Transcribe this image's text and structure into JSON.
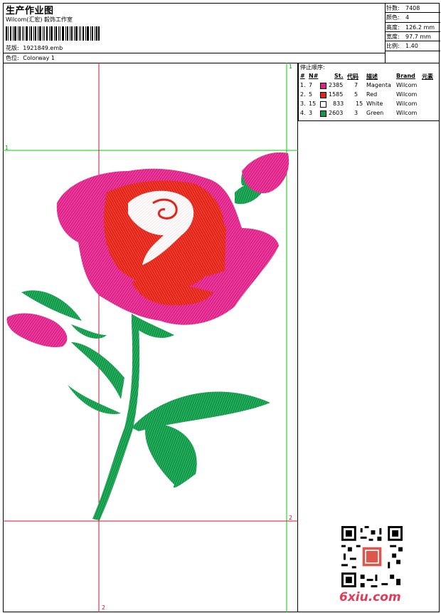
{
  "header": {
    "title": "生产作业图",
    "subtitle": "Wilcom(汇宏) 毅饰工作室",
    "design_file_label": "花版:",
    "design_file": "1921849.emb",
    "colorway_label": "色位:",
    "colorway": "Colorway 1"
  },
  "stats": [
    {
      "label": "针数:",
      "value": "7408"
    },
    {
      "label": "颜色:",
      "value": "4"
    },
    {
      "label": "高度:",
      "value": "126.2 mm"
    },
    {
      "label": "宽度:",
      "value": "97.7 mm"
    },
    {
      "label": "比例:",
      "value": "1.40"
    }
  ],
  "stop_sequence": {
    "title": "停止顺序:",
    "headers": {
      "num": "#",
      "n": "N#",
      "st": "St.",
      "code": "代码",
      "desc": "描述",
      "brand": "Brand",
      "elem": "元素"
    },
    "rows": [
      {
        "idx": "1.",
        "n": "7",
        "color": "#e0218a",
        "st": "2385",
        "code": "7",
        "desc": "Magenta",
        "brand": "Wilcom"
      },
      {
        "idx": "2.",
        "n": "5",
        "color": "#e3241b",
        "st": "1585",
        "code": "5",
        "desc": "Red",
        "brand": "Wilcom"
      },
      {
        "idx": "3.",
        "n": "15",
        "color": "#ffffff",
        "st": "833",
        "code": "15",
        "desc": "White",
        "brand": "Wilcom"
      },
      {
        "idx": "4.",
        "n": "3",
        "color": "#0f9a4a",
        "st": "2603",
        "code": "3",
        "desc": "Green",
        "brand": "Wilcom"
      }
    ]
  },
  "guides": {
    "label_1": "1",
    "label_2": "2"
  },
  "watermark": "6xiu.com",
  "colors": {
    "guide_green": "#00d000",
    "guide_red": "#d01030",
    "magenta": "#e0218a",
    "red": "#e3241b",
    "green": "#0f9a4a"
  }
}
